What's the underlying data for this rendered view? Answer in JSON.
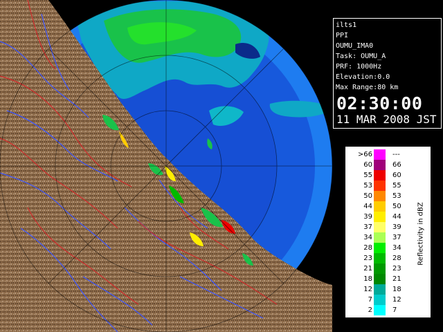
{
  "radar_info": {
    "site": "ilts1",
    "product": "PPI",
    "config": "OUMU_IMA0",
    "task": "Task: OUMU_A",
    "prf": "PRF: 1000Hz",
    "elevation": "Elevation:0.0",
    "max_range": "Max Range:80 km",
    "time": "02:30:00",
    "date": "11 MAR 2008 JST"
  },
  "legend": {
    "title": "Reflectivity in dBZ",
    "rows": [
      {
        "lo": ">66",
        "hi": "---",
        "color": "#ff00ff"
      },
      {
        "lo": "60",
        "hi": "66",
        "color": "#a0007a"
      },
      {
        "lo": "55",
        "hi": "60",
        "color": "#ee0000"
      },
      {
        "lo": "53",
        "hi": "55",
        "color": "#ff3300"
      },
      {
        "lo": "50",
        "hi": "53",
        "color": "#ff8800"
      },
      {
        "lo": "44",
        "hi": "50",
        "color": "#ffcc00"
      },
      {
        "lo": "39",
        "hi": "44",
        "color": "#ffee00"
      },
      {
        "lo": "37",
        "hi": "39",
        "color": "#ffff66"
      },
      {
        "lo": "34",
        "hi": "37",
        "color": "#aaff55"
      },
      {
        "lo": "28",
        "hi": "34",
        "color": "#00ee00"
      },
      {
        "lo": "23",
        "hi": "28",
        "color": "#00bb00"
      },
      {
        "lo": "21",
        "hi": "23",
        "color": "#009900"
      },
      {
        "lo": "18",
        "hi": "21",
        "color": "#008800"
      },
      {
        "lo": "12",
        "hi": "18",
        "color": "#00aa99"
      },
      {
        "lo": "7",
        "hi": "12",
        "color": "#00cccc"
      },
      {
        "lo": "2",
        "hi": "7",
        "color": "#00ffff"
      }
    ]
  },
  "colors": {
    "ocean_near": "#1650d8",
    "ocean_far": "#1e7cf0",
    "land": "#8a6a48",
    "river": "#3c56ff",
    "boundary": "#d02b2b",
    "range_ring": "#000000"
  }
}
